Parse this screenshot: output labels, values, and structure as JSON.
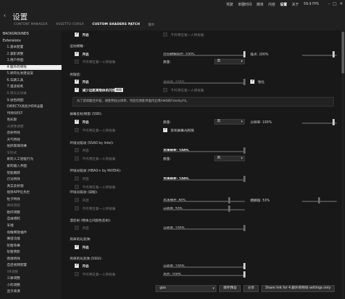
{
  "header": {
    "back": "‹",
    "title": "设置",
    "menu": [
      "驾驶",
      "单圈时间",
      "媒体",
      "内容",
      "设置",
      "关于",
      "59.9 FPS"
    ],
    "menu_active": 4,
    "tabs": [
      "CONTENT MANAGER",
      "ASSETTO CORSA",
      "CUSTOM SHADERS PATCH",
      "额外"
    ],
    "tab_active": 2,
    "search_icon": "search-icon"
  },
  "sidebar": {
    "items": [
      {
        "label": "BACKGROUNDS",
        "type": "hdr"
      },
      {
        "label": "Extensions",
        "type": "hdr"
      },
      {
        "label": "1.基本配置"
      },
      {
        "label": "2.漏影调整"
      },
      {
        "label": "3.用户界面"
      },
      {
        "label": "4.额外的特效",
        "type": "active"
      },
      {
        "label": "5.新的化妆建设案"
      },
      {
        "label": "6.车辆工具"
      },
      {
        "label": "7.速滤视机"
      },
      {
        "label": "8.阴天天效果",
        "type": "dim"
      },
      {
        "label": "9.进色网图"
      },
      {
        "label": "DIRECTX高阶/HDR设置"
      },
      {
        "label": "YEBISEST"
      },
      {
        "label": "色彩斯"
      },
      {
        "label": "光阴像调整",
        "type": "dim"
      },
      {
        "label": "反射特效"
      },
      {
        "label": "天气特效"
      },
      {
        "label": "拍风玻璃效果"
      },
      {
        "label": "车轮式",
        "type": "dim"
      },
      {
        "label": "新的人工智能行为"
      },
      {
        "label": "新的输入界面"
      },
      {
        "label": "智能跟踪"
      },
      {
        "label": "灯光特效"
      },
      {
        "label": "真实反射镜"
      },
      {
        "label": "程序APP任务栏"
      },
      {
        "label": "粒子特效"
      },
      {
        "label": "赛场调控",
        "type": "dim"
      },
      {
        "label": "胎印调整"
      },
      {
        "label": "自由相机"
      },
      {
        "label": "车相"
      },
      {
        "label": "视角释放插件"
      },
      {
        "label": "赛道功能"
      },
      {
        "label": "轮胎效果"
      },
      {
        "label": "轮胎阴影"
      },
      {
        "label": "雨滴特效"
      },
      {
        "label": "自启视频配置"
      },
      {
        "label": "VR调整",
        "type": "dim"
      },
      {
        "label": "三屏调整"
      },
      {
        "label": "小的调整"
      },
      {
        "label": "显示来源"
      }
    ]
  },
  "main": {
    "enable": "开启",
    "first_person": "不作用在第一人称视角",
    "motion_blur": {
      "title": "运动模糊:",
      "strength": "运动模糊强度: 100%",
      "noise": "噪点: 200%"
    },
    "aa": {
      "title": "抗锯齿:",
      "sample": "采样值: 100%",
      "sharpen": "锐化",
      "reduce_flicker": "减少远距离物体的闪烁",
      "new_badge": "新版",
      "quality_label": "质量:",
      "quality_value": "高",
      "note": "为了获得最佳外观，请使用低分辨率，然后在阴影界面内启用AMD的FidelityFX。"
    },
    "ssr": {
      "title": "屏幕反射/倒影 (SSR):",
      "quality_label": "质量:",
      "quality_value": "高",
      "res": "分辨率: 100%",
      "affect_ssr": "影响屏幕光照镜"
    },
    "ssao": {
      "title": "环境光吸收 (SSAO by Intel):",
      "opacity": "不透明度: 100%",
      "quality_label": "质量:",
      "quality_value": "高"
    },
    "hbao": {
      "title": "环境光吸收 (HBAO+ by NVIDIA):",
      "opacity": "不透明度: 100%"
    },
    "old_ao": {
      "title": "环境光吸收 (旧版):",
      "opacity": "不透明度: 80%",
      "blur": "模糊值: 50%",
      "res": "分辨率: 50%"
    },
    "reflect": {
      "title": "漫反射 (物体之间颜色反射):",
      "res": "分辨率: 100%"
    },
    "glow": {
      "title": "简单的光反弹:"
    },
    "ssgi": {
      "title": "简单的光反弹 (SSGI):",
      "res": "分辨率: 100%",
      "brightness": "亮度: 100%"
    }
  },
  "bottom": {
    "preset_value": "goo",
    "save_preset": "保存预设",
    "share": "分享",
    "share_link": "Share link for 4.额外的特效 settings only"
  },
  "colors": {
    "bg": "#181818",
    "sidebar": "#1d1d1d",
    "active": "#f0f0f0"
  }
}
